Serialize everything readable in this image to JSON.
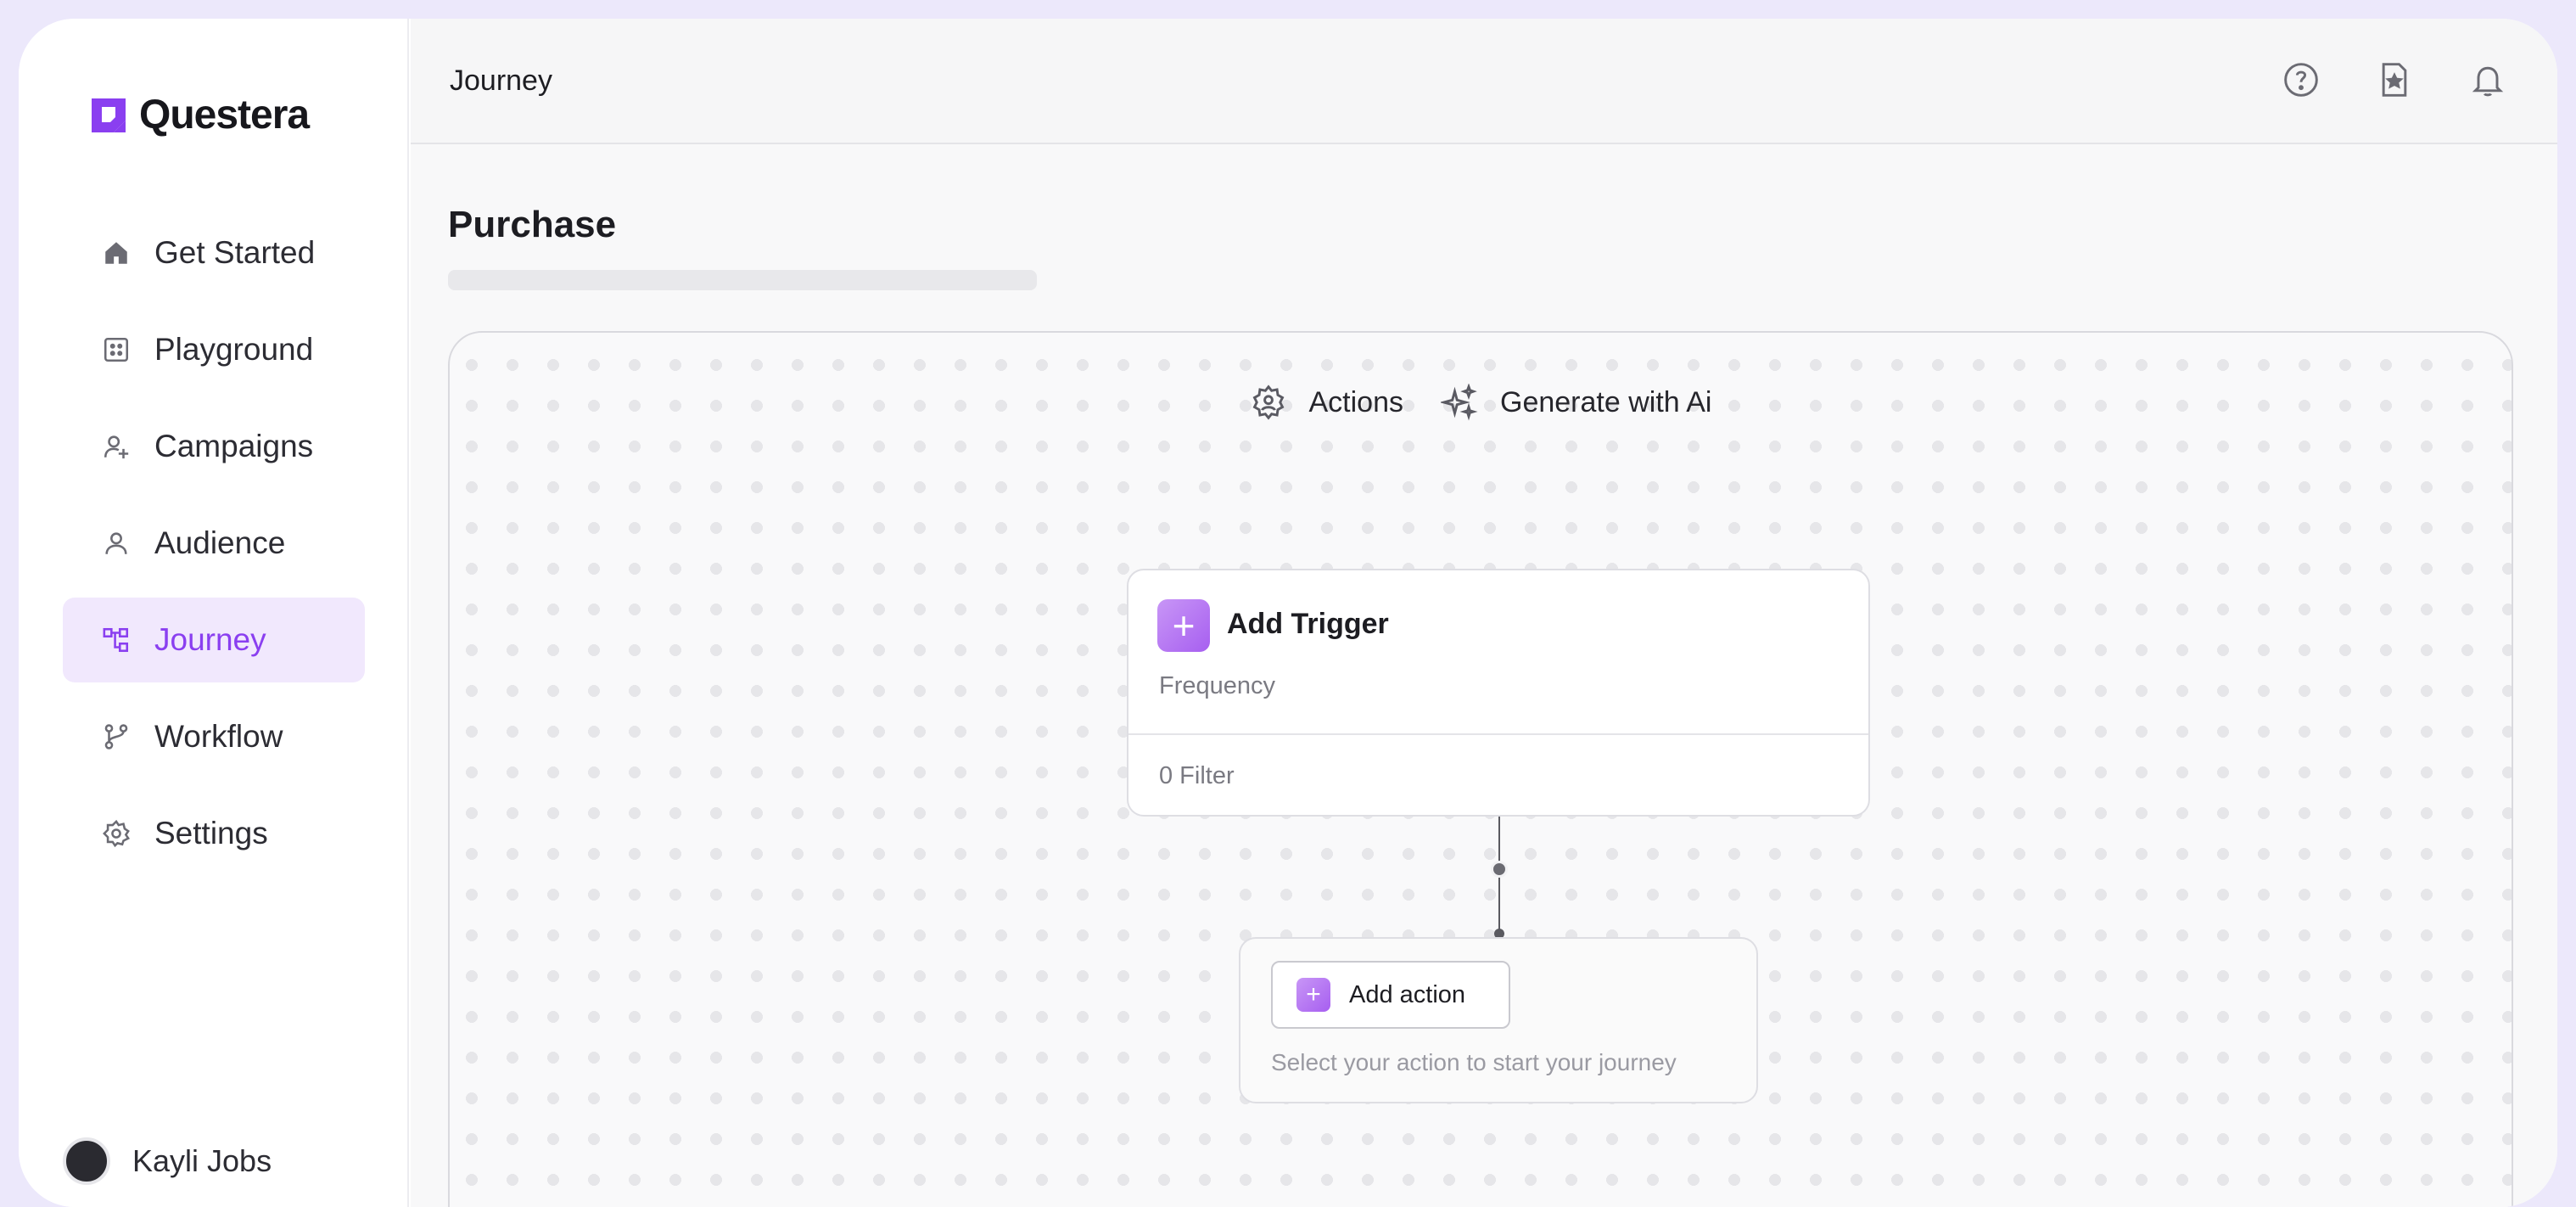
{
  "app": {
    "name": "Questera"
  },
  "sidebar": {
    "items": [
      {
        "label": "Get Started",
        "icon": "home-icon"
      },
      {
        "label": "Playground",
        "icon": "grid-icon"
      },
      {
        "label": "Campaigns",
        "icon": "user-plus-icon"
      },
      {
        "label": "Audience",
        "icon": "user-icon"
      },
      {
        "label": "Journey",
        "icon": "journey-icon",
        "active": true
      },
      {
        "label": "Workflow",
        "icon": "workflow-icon"
      },
      {
        "label": "Settings",
        "icon": "gear-icon"
      }
    ],
    "user": {
      "name": "Kayli Jobs"
    }
  },
  "header": {
    "title": "Journey",
    "icons": [
      "help-icon",
      "bookmark-icon",
      "bell-icon"
    ]
  },
  "main": {
    "page_title": "Purchase",
    "toolbar": {
      "actions_label": "Actions",
      "generate_label": "Generate with Ai"
    },
    "trigger": {
      "title": "Add Trigger",
      "subtitle": "Frequency",
      "filter": "0 Filter"
    },
    "action": {
      "button_label": "Add action",
      "hint": "Select your action to start your journey"
    }
  },
  "colors": {
    "accent": "#8a3ff0",
    "accent_bg": "#f1e8fd",
    "frame_bg": "#ece8fb"
  }
}
